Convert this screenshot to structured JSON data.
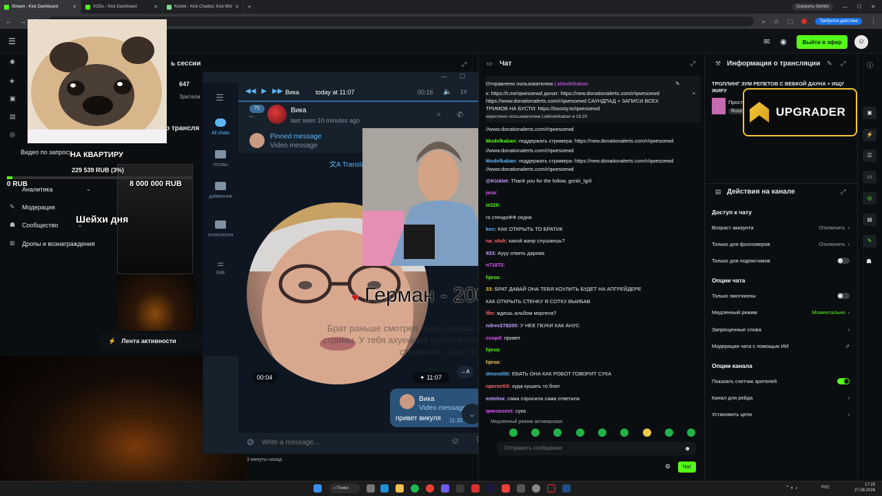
{
  "browser": {
    "tabs": [
      {
        "title": "Stream - Kick Dashboard",
        "active": true
      },
      {
        "title": "VODs - Kick Dashboard",
        "active": false
      },
      {
        "title": "Kicklet - Kick Chatbot, Kick Wid",
        "active": false
      }
    ],
    "gemini_label": "Спросить Gemini",
    "action_needed": "Требуется действие"
  },
  "kick": {
    "go_live": "Выйти в эфир",
    "sidebar": {
      "video_request": "Видео по запросу",
      "items": [
        "Аналитика",
        "Модерация",
        "Сообщество",
        "Дропы и вознаграждения"
      ],
      "activity_feed": "Лента активности"
    },
    "session": {
      "title": "ь сессии",
      "viewers_count": "647",
      "viewers_label": "Зрители",
      "stream_label": "р трансля",
      "ago": "3 минуты назад"
    }
  },
  "overlay": {
    "apartment_goal": "НА КВАРТИРУ",
    "rub_collected": "229 539 RUB (3%)",
    "zero_rub": "0 RUB",
    "goal_amount": "8 000 000 RUB",
    "shakes": "Шейхи дня",
    "german_caption": "Герман - 2000",
    "donation_text": "Брат раньше смотрел твои нарезки в тик токе теперь смотрю стримы. У тебя ахуенный контент спасибо что радуешь своими стримами - Брат Я Герман"
  },
  "telegram": {
    "player": {
      "name": "Вика",
      "time": "today at 11:07",
      "duration": "00:16",
      "speed": "1X"
    },
    "chat_header": {
      "name": "Вика",
      "status": "last seen 10 minutes ago",
      "unread": "71"
    },
    "pinned": {
      "title": "Pinned message",
      "subtitle": "Video message"
    },
    "translate": "Transla",
    "folders": [
      "All chats",
      "готовы",
      "дайвинчик",
      "психология",
      "Edit"
    ],
    "video_duration": "00:04",
    "video_time": "11:07",
    "reply": {
      "name": "Вика",
      "type": "Video message",
      "text": "привет викуля",
      "time": "11:35"
    },
    "input_placeholder": "Write a message..."
  },
  "chat": {
    "title": "Чат",
    "pinned_by_prefix": "Отправлено пользователем",
    "pinned_by_user": "LaModelkaban",
    "pinned_line1": "к: https://t.me/qwesoewd донат: https://new.donationalerts.com/r/qwesoewd",
    "pinned_line2": "https://www.donationalerts.com/r/qwesoewd САУНДПАД + ЗАПИСИ ВСЕХ",
    "pinned_line3": "ТРИМОВ НА БУСТИ: https://boosty.to/qwesoewd",
    "pinned_meta": "икреплено пользователем LaModelkaban в 16:20",
    "messages": [
      {
        "user": "",
        "text": "//www.donationalerts.com/r/qwesoewd"
      },
      {
        "user": "Modelkaban:",
        "text": "поддержать стримера: https://new.donationalerts.com/r/qwesoewd"
      },
      {
        "user": "",
        "text": "//www.donationalerts.com/r/qwesoewd"
      },
      {
        "user": "Modelkaban:",
        "text": "поддержать стримера: https://new.donationalerts.com/r/qwesoewd"
      },
      {
        "user": "",
        "text": "//www.donationalerts.com/r/qwesoewd"
      },
      {
        "user": "@Kicklet:",
        "text": "Thank you for the follow, gonki_lgril"
      },
      {
        "user": "jesa:",
        "text": ""
      },
      {
        "user": "ie226:",
        "text": ""
      },
      {
        "user": "",
        "text": "го стендоФФ седня"
      },
      {
        "user": "ken:",
        "text": "КАК ОТКРЫТЬ ТО БРАТИК"
      },
      {
        "user": "na_oluh:",
        "text": "какой жанр слушаешь?"
      },
      {
        "user": "933:",
        "text": "Аууу ответь дарова"
      },
      {
        "user": "n71872:",
        "text": ""
      },
      {
        "user": "hjesa:",
        "text": ""
      },
      {
        "user": "33:",
        "text": "БРАТ ДАВАЙ ОНА ТЕБЯ КОУЛИТЬ БУДЕТ НА АПГРЕЙДЕРЕ"
      },
      {
        "user": "",
        "text": "КАК ОТКРЫТЬ СТЕНКУ Я СОТКУ ВЫИБАВ"
      },
      {
        "user": "lfin:",
        "text": "ждешь альбом моргена?"
      },
      {
        "user": "ndrev278200:",
        "text": "У НЕЕ ГБУКИ КАК АНУС"
      },
      {
        "user": "csopd:",
        "text": "привет"
      },
      {
        "user": "hjesa:",
        "text": ""
      },
      {
        "user": "hjesa:",
        "text": ""
      },
      {
        "user": "dmond06:",
        "text": "ЕБАТЬ ОНА КАК РОБОТ ГОВОРИТ СУКА"
      },
      {
        "user": "nperorXX:",
        "text": "куда кушать то блят"
      },
      {
        "user": "entolna:",
        "text": "сама спросила сама ответила"
      },
      {
        "user": "qwesosest:",
        "text": "сука"
      }
    ],
    "slow_mode": "Медленный режим активирован",
    "input_placeholder": "Отправить сообщение",
    "send_label": "Чат"
  },
  "stream_info": {
    "title": "Информация о трансляции",
    "stream_title": "ТРОЛЛИНГ ЗУМ РЕПЕТОВ С ВЕБКОЙ ДАУНА + ИЩУ ЖИРУ",
    "category": "Прост",
    "lang": "Russ"
  },
  "sponsor": {
    "name": "UPGRADER"
  },
  "channel_actions": {
    "title": "Действия на канале",
    "chat_access": "Доступ к чату",
    "account_age": {
      "label": "Возраст аккаунта",
      "value": "Отключить"
    },
    "followers_only": {
      "label": "Только для фолловеров",
      "value": "Отключить"
    },
    "subs_only": {
      "label": "Только для подписчиков"
    },
    "chat_options": "Опции чата",
    "emotes_only": {
      "label": "Только эмотиконы"
    },
    "slow_mode": {
      "label": "Медленный режим",
      "value": "Моментально"
    },
    "banned_words": {
      "label": "Запрещенные слова"
    },
    "ai_moderation": {
      "label": "Модерация чата с помощью ИИ"
    },
    "channel_options": "Опции канала",
    "show_viewers": {
      "label": "Показать счетчик зрителей"
    },
    "raid_channel": {
      "label": "Канал для рейда"
    },
    "set_goals": {
      "label": "Установить цели"
    }
  },
  "taskbar": {
    "search": "Поиск",
    "lang": "РУС",
    "time": "17:25",
    "date": "27.08.2026"
  },
  "colors": {
    "kick_green": "#53fc18",
    "telegram_blue": "#5eb5f7",
    "upgrader_gold": "#f7c83a"
  }
}
